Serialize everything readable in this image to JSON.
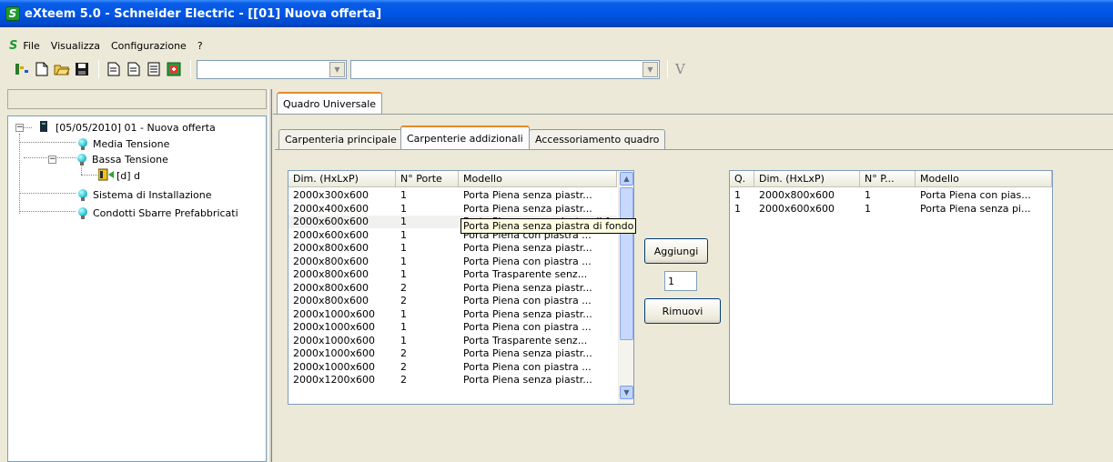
{
  "window": {
    "title": "eXteem 5.0 - Schneider Electric - [[01] Nuova offerta]"
  },
  "menu": {
    "items": [
      "File",
      "Visualizza",
      "Configurazione",
      "?"
    ]
  },
  "toolbar": {
    "buttons": [
      "tree-icon",
      "new-document-icon",
      "open-folder-icon",
      "save-icon",
      "report-icon",
      "report-icon",
      "list-report-icon",
      "export-icon"
    ],
    "combo1": "",
    "combo2": "",
    "v_label": "V"
  },
  "tree": {
    "root": "[05/05/2010] 01 - Nuova offerta",
    "media": "Media Tensione",
    "bassa": "Bassa Tensione",
    "bassa_child": "[d] d",
    "sistema": "Sistema di Installazione",
    "condotti": "Condotti Sbarre Prefabbricati"
  },
  "tabs": {
    "outer": "Quadro Universale",
    "inner": [
      "Carpenteria principale",
      "Carpenterie addizionali",
      "Accessoriamento quadro"
    ]
  },
  "available_list": {
    "columns": [
      "Dim. (HxLxP)",
      "N° Porte",
      "Modello"
    ],
    "rows": [
      [
        "2000x300x600",
        "1",
        "Porta Piena senza piastr..."
      ],
      [
        "2000x400x600",
        "1",
        "Porta Piena senza piastr..."
      ],
      [
        "2000x600x600",
        "1",
        "Porta Piena senza piastra di fondo"
      ],
      [
        "2000x600x600",
        "1",
        "Porta Piena con piastra ..."
      ],
      [
        "2000x800x600",
        "1",
        "Porta Piena senza piastr..."
      ],
      [
        "2000x800x600",
        "1",
        "Porta Piena con piastra ..."
      ],
      [
        "2000x800x600",
        "1",
        "Porta Trasparente senz..."
      ],
      [
        "2000x800x600",
        "2",
        "Porta Piena senza piastr..."
      ],
      [
        "2000x800x600",
        "2",
        "Porta Piena con piastra ..."
      ],
      [
        "2000x1000x600",
        "1",
        "Porta Piena senza piastr..."
      ],
      [
        "2000x1000x600",
        "1",
        "Porta Piena con piastra ..."
      ],
      [
        "2000x1000x600",
        "1",
        "Porta Trasparente senz..."
      ],
      [
        "2000x1000x600",
        "2",
        "Porta Piena senza piastr..."
      ],
      [
        "2000x1000x600",
        "2",
        "Porta Piena con piastra ..."
      ],
      [
        "2000x1200x600",
        "2",
        "Porta Piena senza piastr..."
      ]
    ],
    "tooltip": "Porta Piena senza piastra di fondo"
  },
  "actions": {
    "add_label": "Aggiungi",
    "quantity": "1",
    "remove_label": "Rimuovi"
  },
  "selected_list": {
    "columns": [
      "Q.",
      "Dim. (HxLxP)",
      "N° P...",
      "Modello"
    ],
    "rows": [
      [
        "1",
        "2000x800x600",
        "1",
        "Porta Piena con pias..."
      ],
      [
        "1",
        "2000x600x600",
        "1",
        "Porta Piena senza pi..."
      ]
    ]
  }
}
